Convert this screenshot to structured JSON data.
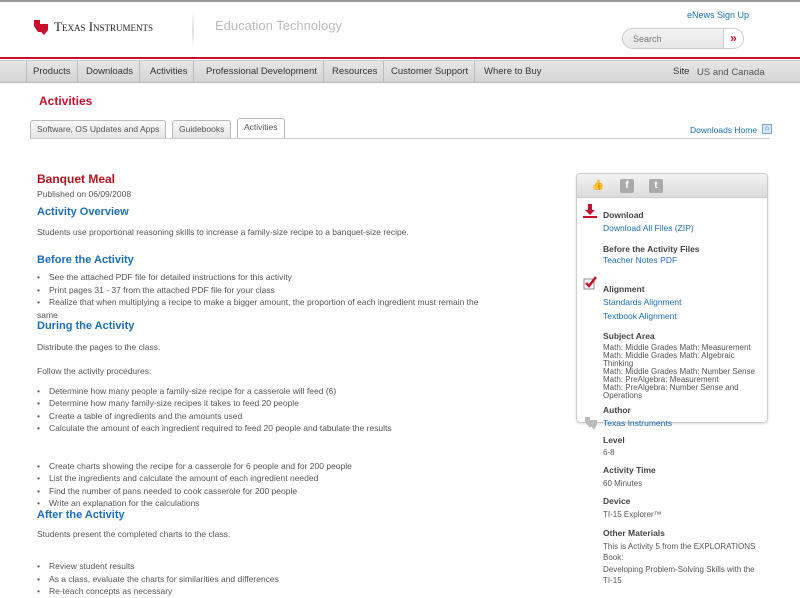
{
  "header": {
    "brand": "Texas Instruments",
    "section": "Education Technology",
    "enews": "eNews Sign Up",
    "search_placeholder": "Search",
    "search_go": "»"
  },
  "nav": {
    "items": [
      "Products",
      "Downloads",
      "Activities",
      "Professional Development",
      "Resources",
      "Customer Support",
      "Where to Buy"
    ],
    "site_label": "Site",
    "site_value": "US and Canada"
  },
  "page": {
    "heading": "Activities",
    "tabs": [
      "Software, OS Updates and Apps",
      "Guidebooks",
      "Activities"
    ],
    "downloads_home": "Downloads Home"
  },
  "activity": {
    "title": "Banquet Meal",
    "published": "Published on 06/09/2008",
    "overview_h": "Activity Overview",
    "overview": "Students use proportional reasoning skills to increase a family-size recipe to a banquet-size recipe.",
    "before_h": "Before the Activity",
    "before": [
      "See the attached PDF file for detailed instructions for this activity",
      "Print pages 31 - 37 from the attached PDF file for your class",
      "Realize that when multiplying a recipe to make a bigger amount, the proportion of each ingredient must remain the",
      "same"
    ],
    "during_h": "During the Activity",
    "during_p1": "Distribute the pages to the class.",
    "during_p2": "Follow the activity procedures:",
    "during_a": [
      "Determine how many people a family-size recipe for a casserole will feed (6)",
      "Determine how many family-size recipes it takes to feed 20 people",
      "Create a table of ingredients and the amounts used",
      "Calculate the amount of each ingredient required to feed 20 people and tabulate the results"
    ],
    "during_b": [
      "Create charts showing the recipe for a casserole for 6 people and for 200 people",
      "List the ingredients and calculate the amount of each ingredient needed",
      "Find the number of pans needed to cook casserole for 200 people",
      "Write an explanation for the calculations"
    ],
    "after_h": "After the Activity",
    "after_p": "Students present the completed charts to the class.",
    "after": [
      "Review student results",
      "As a class, evaluate the charts for similarities and differences",
      "Re-teach concepts as necessary"
    ]
  },
  "sidebar": {
    "download_h": "Download",
    "download_all": "Download All Files (ZIP)",
    "before_files_h": "Before the Activity Files",
    "teacher_notes": "Teacher Notes PDF",
    "alignment_h": "Alignment",
    "standards": "Standards Alignment",
    "textbook": "Textbook Alignment",
    "subject_h": "Subject Area",
    "subjects": [
      "Math: Middle Grades Math: Measurement",
      "Math: Middle Grades Math: Algebraic",
      "Thinking",
      "Math: Middle Grades Math: Number Sense",
      "Math: PreAlgebra: Measurement",
      "Math: PreAlgebra: Number Sense and",
      "Operations"
    ],
    "author_h": "Author",
    "author": "Texas Instruments",
    "level_h": "Level",
    "level": "6-8",
    "time_h": "Activity Time",
    "time": "60 Minutes",
    "device_h": "Device",
    "device": "TI-15 Explorer™",
    "other_h": "Other Materials",
    "other": [
      "This is Activity 5 from the EXPLORATIONS",
      "Book:",
      "Developing Problem-Solving Skills with the",
      "TI-15"
    ]
  },
  "colors": {
    "brand_red": "#c8102e",
    "link_blue": "#1a6fb5"
  }
}
